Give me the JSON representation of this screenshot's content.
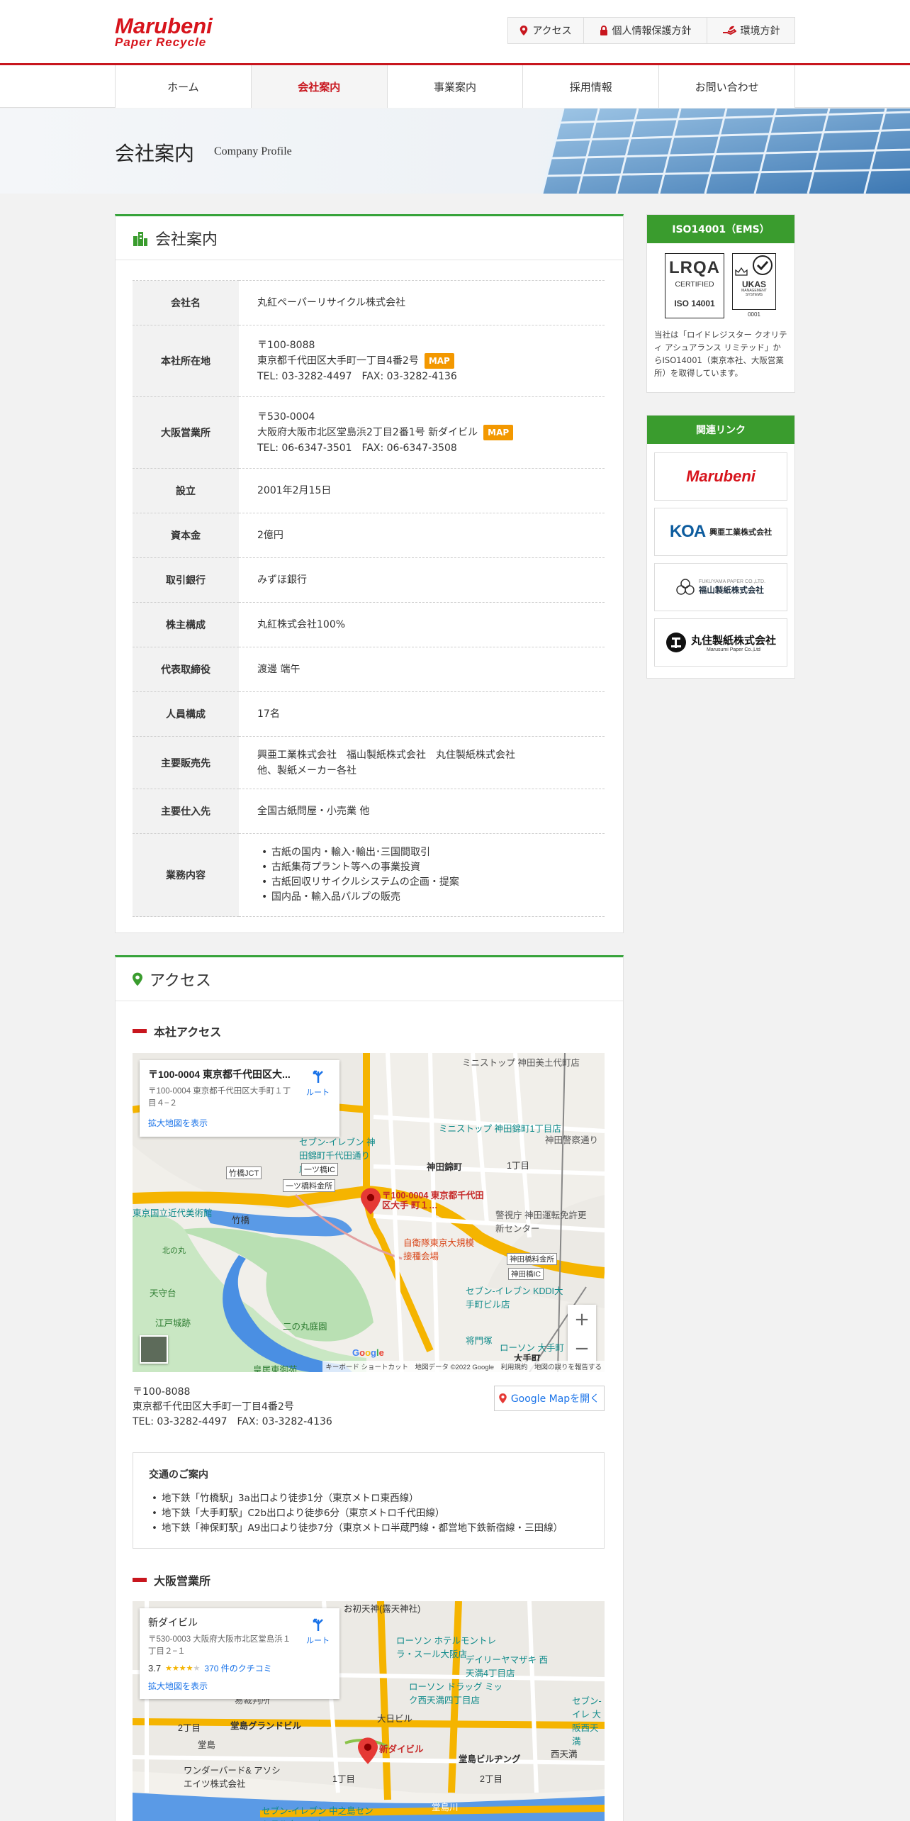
{
  "header": {
    "logo_main": "Marubeni",
    "logo_sub": "Paper Recycle",
    "util": [
      {
        "label": "アクセス",
        "icon": "pin-icon"
      },
      {
        "label": "個人情報保護方針",
        "icon": "lock-icon"
      },
      {
        "label": "環境方針",
        "icon": "leaf-hand-icon"
      }
    ]
  },
  "nav": {
    "items": [
      "ホーム",
      "会社案内",
      "事業案内",
      "採用情報",
      "お問い合わせ"
    ],
    "active": "会社案内"
  },
  "hero": {
    "title": "会社案内",
    "subtitle": "Company Profile"
  },
  "company": {
    "heading": "会社案内",
    "map_label": "MAP",
    "rows": {
      "name": {
        "label": "会社名",
        "value": "丸紅ペーパーリサイクル株式会社"
      },
      "hq": {
        "label": "本社所在地",
        "zip": "〒100-8088",
        "addr": "東京都千代田区大手町一丁目4番2号",
        "tel": "TEL: 03-3282-4497　FAX: 03-3282-4136"
      },
      "osaka": {
        "label": "大阪営業所",
        "zip": "〒530-0004",
        "addr": "大阪府大阪市北区堂島浜2丁目2番1号 新ダイビル",
        "tel": "TEL: 06-6347-3501　FAX: 06-6347-3508"
      },
      "founded": {
        "label": "設立",
        "value": "2001年2月15日"
      },
      "capital": {
        "label": "資本金",
        "value": "2億円"
      },
      "bank": {
        "label": "取引銀行",
        "value": "みずほ銀行"
      },
      "shareholders": {
        "label": "株主構成",
        "value": "丸紅株式会社100%"
      },
      "ceo": {
        "label": "代表取締役",
        "value": "渡邊 端午"
      },
      "staff": {
        "label": "人員構成",
        "value": "17名"
      },
      "customers": {
        "label": "主要販売先",
        "line1": "興亜工業株式会社　福山製紙株式会社　丸住製紙株式会社",
        "line2": "他、製紙メーカー各社"
      },
      "suppliers": {
        "label": "主要仕入先",
        "value": "全国古紙問屋・小売業 他"
      },
      "business": {
        "label": "業務内容",
        "items": [
          "古紙の国内・輸入･輸出･三国間取引",
          "古紙集荷プラント等への事業投資",
          "古紙回収リサイクルシステムの企画・提案",
          "国内品・輸入品パルプの販売"
        ]
      }
    }
  },
  "sidebar": {
    "iso": {
      "heading": "ISO14001（EMS）",
      "lrqa": "LRQA",
      "certified": "CERTIFIED",
      "iso_no": "ISO 14001",
      "ukas": "UKAS",
      "ukas_sub": "MANAGEMENT SYSTEMS",
      "ukas_no": "0001",
      "text": "当社は「ロイドレジスター クオリティ アシュアランス リミテッド」からISO14001（東京本社、大阪営業所）を取得しています。"
    },
    "links": {
      "heading": "関連リンク",
      "marubeni": "Marubeni",
      "koa": "KOA",
      "koa_name": "興亜工業株式会社",
      "fukuyama_en": "FUKUYAMA PAPER CO.,LTD.",
      "fukuyama": "福山製紙株式会社",
      "marusumi": "丸住製紙株式会社",
      "marusumi_en": "Marusumi Paper Co.,Ltd"
    }
  },
  "access": {
    "heading": "アクセス",
    "hq": {
      "title": "本社アクセス",
      "map_card_title": "〒100-0004 東京都千代田区大...",
      "map_card_addr": "〒100-0004 東京都千代田区大手町１丁目４−２",
      "route": "ルート",
      "enlarge": "拡大地図を表示",
      "pin_label": "〒100-0004 東京都千代田区大手 町１…",
      "map_labels": [
        "ミニストップ 神田美土代町店",
        "ミニストップ 神田錦町1丁目店",
        "セブン-イレブン 神田錦町千代田通り店",
        "神田錦町",
        "1丁目",
        "神田警察通り",
        "一ツ橋IC",
        "竹橋JCT",
        "一ツ橋料金所",
        "竹橋",
        "東京国立近代美術館",
        "北の丸",
        "警視庁 神田運転免許更新センター",
        "自衛隊東京大規模接種会場",
        "神田橋料金所",
        "神田橋IC",
        "天守台",
        "江戸城跡",
        "二の丸庭園",
        "セブン-イレブン KDDI大手町ビル店",
        "将門塚",
        "ローソン 大手町",
        "大手町",
        "皇居東御苑"
      ],
      "attribution": "キーボード ショートカット　地図データ ©2022 Google　利用規約　地図の誤りを報告する",
      "zip": "〒100-8088",
      "addr": "東京都千代田区大手町一丁目4番2号",
      "tel": "TEL: 03-3282-4497　FAX: 03-3282-4136",
      "gmap_btn": "Google Mapを開く",
      "traffic_title": "交通のご案内",
      "traffic": [
        "地下鉄「竹橋駅」3a出口より徒歩1分（東京メトロ東西線）",
        "地下鉄「大手町駅」C2b出口より徒歩6分（東京メトロ千代田線）",
        "地下鉄「神保町駅」A9出口より徒歩7分（東京メトロ半蔵門線・都営地下鉄新宿線・三田線）"
      ]
    },
    "osaka": {
      "title": "大阪営業所",
      "map_card_title": "新ダイビル",
      "map_card_addr": "〒530-0003 大阪府大阪市北区堂島浜１丁目２−１",
      "rating": "3.7",
      "stars": 3.7,
      "reviews": "370 件のクチコミ",
      "route": "ルート",
      "enlarge": "拡大地図を表示",
      "pin_label": "新ダイビル",
      "map_labels": [
        "お初天神(露天神社)",
        "ローソン ホテルモントレ ラ・スール大阪店",
        "デイリーヤマザキ 西天満4丁目店",
        "ローソン ドラッグ ミック西天満四丁目店",
        "大阪高等・地方・簡易裁判所",
        "大日ビル",
        "堂島グランドビル",
        "堂島",
        "2丁目",
        "ワンダーバード& アソシエイツ株式会社",
        "堂島ビルヂング",
        "西天満",
        "セブン-イレブン 中之島セントラルタワー店",
        "堂島川",
        "2丁目",
        "1丁目",
        "セブン-イレ 大阪西天満"
      ]
    }
  },
  "colors": {
    "brand_red": "#c8161e",
    "accent_green": "#3a9c2e",
    "map_btn": "#f39800",
    "link_blue": "#1a73e8"
  }
}
